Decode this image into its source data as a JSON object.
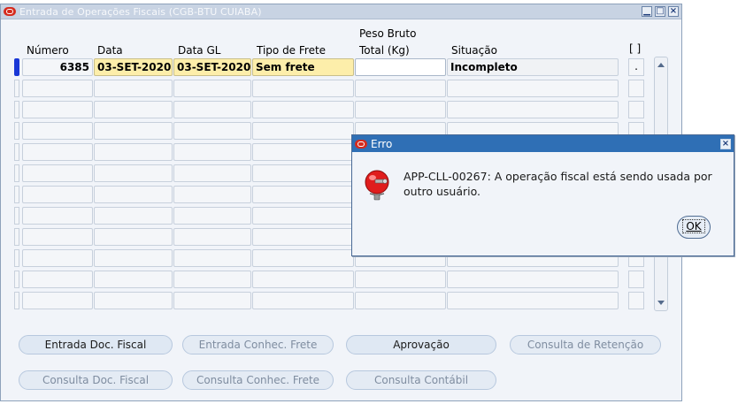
{
  "window": {
    "title": "Entrada de Operações Fiscais (CGB-BTU CUIABA)",
    "controls": {
      "minimize": "▁",
      "maximize": "□",
      "close": "×"
    }
  },
  "table": {
    "headers": {
      "numero": "Número",
      "data": "Data",
      "data_gl": "Data GL",
      "tipo_frete": "Tipo de Frete",
      "peso_line1": "Peso Bruto",
      "peso_line2": "Total (Kg)",
      "situacao": "Situação",
      "check": "[  ]"
    },
    "first_row": {
      "numero": "6385",
      "data": "03-SET-2020",
      "data_gl": "03-SET-2020",
      "tipo_frete": "Sem frete",
      "peso": "",
      "situacao": "Incompleto",
      "check": "."
    }
  },
  "buttons": {
    "entrada_doc": "Entrada Doc. Fiscal",
    "entrada_conhec": "Entrada Conhec. Frete",
    "aprovacao": "Aprovação",
    "consulta_retencao": "Consulta de Retenção",
    "consulta_doc": "Consulta Doc. Fiscal",
    "consulta_conhec": "Consulta Conhec. Frete",
    "consulta_contabil": "Consulta Contábil"
  },
  "dialog": {
    "title": "Erro",
    "message": "APP-CLL-00267: A operação fiscal está sendo usada por outro usuário.",
    "ok": "OK"
  },
  "colors": {
    "dialog_title_bar": "#2f6fb5",
    "required_field": "#fdeeaa",
    "active_row_indicator": "#1937d6",
    "oracle_red": "#d52b1e"
  }
}
